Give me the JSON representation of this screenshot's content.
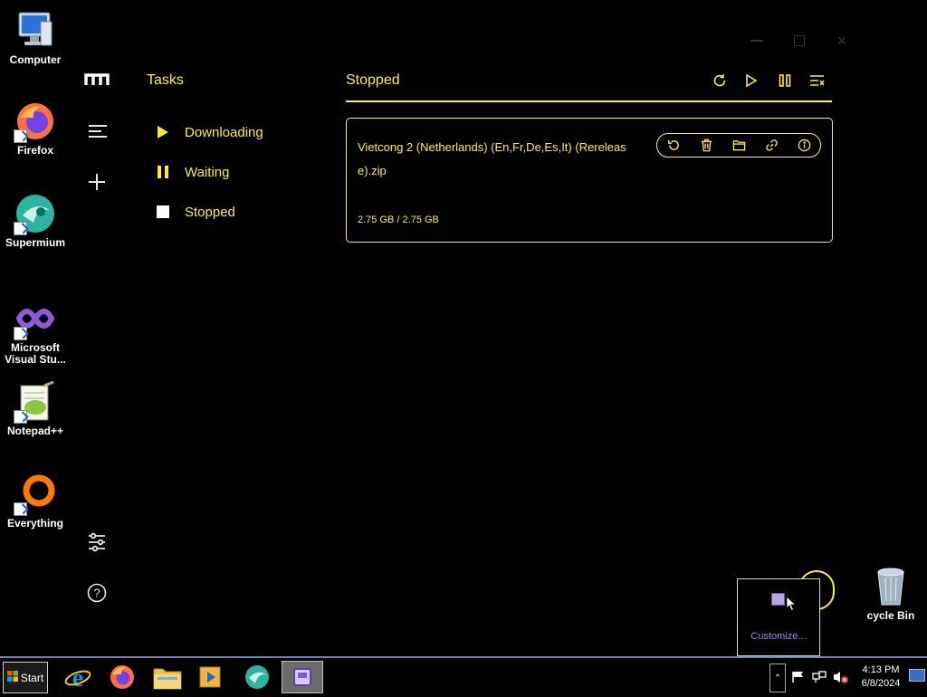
{
  "desktop": {
    "icons": [
      {
        "label": "Computer"
      },
      {
        "label": "Firefox"
      },
      {
        "label": "Supermium"
      },
      {
        "label": "Microsoft Visual Stu..."
      },
      {
        "label": "Notepad++"
      },
      {
        "label": "Everything"
      },
      {
        "label": "cycle Bin"
      }
    ]
  },
  "app": {
    "nav_title": "Tasks",
    "nav_items": [
      {
        "label": "Downloading",
        "icon": "play-icon"
      },
      {
        "label": "Waiting",
        "icon": "pause-icon"
      },
      {
        "label": "Stopped",
        "icon": "stop-icon"
      }
    ],
    "header_title": "Stopped",
    "toolbar": [
      "refresh-icon",
      "resume-all-icon",
      "pause-all-icon",
      "clear-list-icon"
    ],
    "tasks": [
      {
        "name": "Vietcong 2 (Netherlands) (En,Fr,De,Es,It) (Rerelease).zip",
        "name_line1": "Vietcong 2 (Netherlands) (En,Fr,De,Es,It) (Rereleas",
        "name_line2": "e).zip",
        "size": "2.75 GB / 2.75 GB",
        "actions": [
          "restart-icon",
          "delete-icon",
          "folder-icon",
          "link-icon",
          "info-icon"
        ]
      }
    ],
    "accent_color": "#ffee33"
  },
  "tray_popup": {
    "customize_label": "Customize..."
  },
  "taskbar": {
    "start_label": "Start",
    "time": "4:13 PM",
    "date": "6/8/2024"
  }
}
